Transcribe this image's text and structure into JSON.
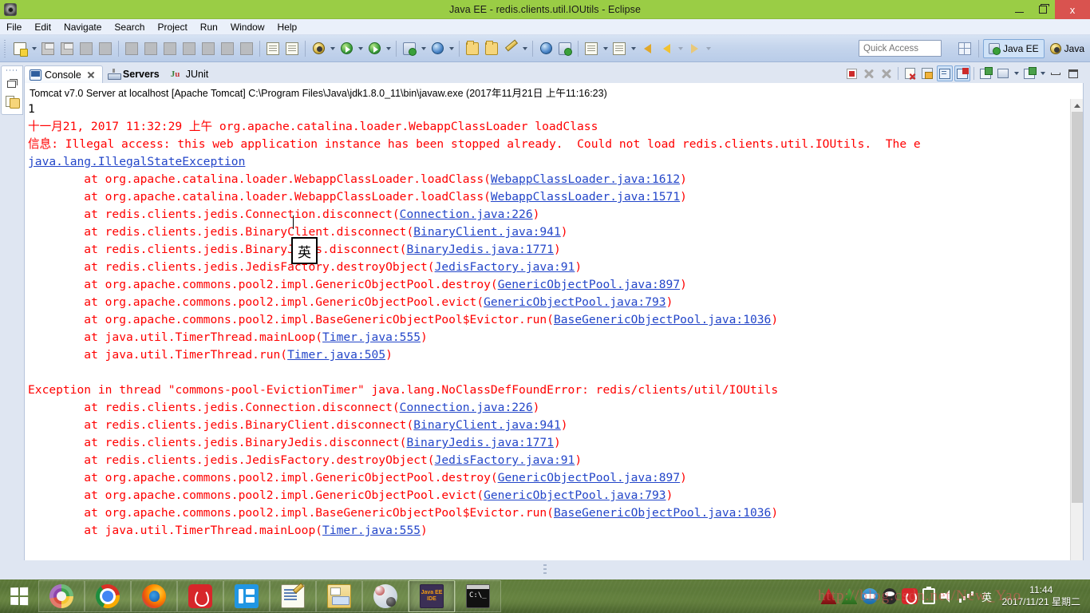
{
  "window": {
    "title": "Java EE - redis.clients.util.IOUtils - Eclipse",
    "app_icon": "eclipse-icon",
    "minimize_label": "–",
    "maximize_label": "❐",
    "close_label": "x"
  },
  "menubar": {
    "items": [
      {
        "label": "File"
      },
      {
        "label": "Edit"
      },
      {
        "label": "Navigate"
      },
      {
        "label": "Search"
      },
      {
        "label": "Project"
      },
      {
        "label": "Run"
      },
      {
        "label": "Window"
      },
      {
        "label": "Help"
      }
    ]
  },
  "toolbar": {
    "quick_access_placeholder": "Quick Access",
    "quick_access_value": "",
    "buttons": [
      {
        "icon": "new-wizard-icon",
        "has_caret": true
      },
      {
        "icon": "save-icon",
        "has_caret": false
      },
      {
        "icon": "save-all-icon",
        "has_caret": false
      },
      {
        "icon": "print-icon",
        "has_caret": false
      },
      {
        "icon": "toggle-breakpoint-icon",
        "has_caret": false
      },
      {
        "icon": "resume-icon",
        "has_caret": false
      },
      {
        "icon": "suspend-icon",
        "has_caret": false
      },
      {
        "icon": "terminate-icon",
        "has_caret": false
      },
      {
        "icon": "disconnect-icon",
        "has_caret": false
      },
      {
        "icon": "step-into-icon",
        "has_caret": false
      },
      {
        "icon": "step-over-icon",
        "has_caret": false
      },
      {
        "icon": "step-return-icon",
        "has_caret": false
      },
      {
        "icon": "open-task-icon",
        "has_caret": false
      },
      {
        "icon": "skip-breakpoints-icon",
        "has_caret": false
      },
      {
        "icon": "debug-icon",
        "has_caret": true
      },
      {
        "icon": "run-icon",
        "has_caret": true
      },
      {
        "icon": "run-external-tools-icon",
        "has_caret": true
      },
      {
        "icon": "new-server-icon",
        "has_caret": true
      },
      {
        "icon": "search-icon",
        "has_caret": true
      },
      {
        "icon": "open-type-icon",
        "has_caret": false
      },
      {
        "icon": "open-resource-icon",
        "has_caret": false
      },
      {
        "icon": "edit-icon",
        "has_caret": true
      },
      {
        "icon": "web-browser-icon",
        "has_caret": false
      },
      {
        "icon": "run-on-server-icon",
        "has_caret": false
      },
      {
        "icon": "new-java-class-icon",
        "has_caret": true
      },
      {
        "icon": "new-annotation-icon",
        "has_caret": true
      },
      {
        "icon": "previous-annotation-icon",
        "has_caret": false
      },
      {
        "icon": "back-icon",
        "has_caret": true
      },
      {
        "icon": "forward-icon",
        "has_caret": true
      }
    ],
    "perspective": {
      "open_perspective_icon": "open-perspective-icon",
      "items": [
        {
          "label": "Java EE",
          "icon": "java-ee-perspective-icon",
          "active": true
        },
        {
          "label": "Java",
          "icon": "java-perspective-icon",
          "active": false
        }
      ]
    }
  },
  "fastview": {
    "items": [
      {
        "icon": "restore-icon",
        "name": "restore"
      },
      {
        "icon": "project-explorer-icon",
        "name": "project-explorer"
      }
    ]
  },
  "view_stack": {
    "tabs": [
      {
        "label": "Console",
        "icon": "console-icon",
        "active": true,
        "closable": true,
        "bold": false
      },
      {
        "label": "Servers",
        "icon": "servers-icon",
        "active": false,
        "closable": false,
        "bold": true
      },
      {
        "label": "JUnit",
        "icon": "junit-icon",
        "active": false,
        "closable": false,
        "bold": false
      }
    ],
    "view_toolbar": [
      {
        "icon": "terminate-icon",
        "enabled": true,
        "toggled": false
      },
      {
        "icon": "remove-launch-icon",
        "enabled": false,
        "toggled": false
      },
      {
        "icon": "remove-all-launches-icon",
        "enabled": false,
        "toggled": false
      },
      {
        "icon": "clear-console-icon",
        "enabled": true,
        "toggled": false
      },
      {
        "icon": "scroll-lock-icon",
        "enabled": true,
        "toggled": false
      },
      {
        "icon": "pin-console-icon",
        "enabled": true,
        "toggled": true
      },
      {
        "icon": "display-selected-console-icon",
        "enabled": true,
        "toggled": true
      },
      {
        "icon": "open-console-icon",
        "enabled": true,
        "toggled": false
      },
      {
        "icon": "display-console-icon",
        "enabled": true,
        "toggled": false
      },
      {
        "icon": "new-console-view-icon",
        "enabled": true,
        "toggled": false
      },
      {
        "icon": "minimize-icon",
        "enabled": true,
        "toggled": false
      },
      {
        "icon": "maximize-icon",
        "enabled": true,
        "toggled": false
      }
    ],
    "console_label": "Tomcat v7.0 Server at localhost [Apache Tomcat] C:\\Program Files\\Java\\jdk1.8.0_11\\bin\\javaw.exe (2017年11月21日 上午11:16:23)"
  },
  "console": {
    "ime_indicator": "英",
    "lines": [
      {
        "kind": "black",
        "text": "1"
      },
      {
        "kind": "red",
        "text": "十一月21, 2017 11:32:29 上午 org.apache.catalina.loader.WebappClassLoader loadClass"
      },
      {
        "kind": "red",
        "text": "信息: Illegal access: this web application instance has been stopped already.  Could not load redis.clients.util.IOUtils.  The e"
      },
      {
        "kind": "link-full",
        "text": "java.lang.IllegalStateException"
      },
      {
        "kind": "trace",
        "prefix": "        at org.apache.catalina.loader.WebappClassLoader.loadClass(",
        "link": "WebappClassLoader.java:1612",
        "suffix": ")"
      },
      {
        "kind": "trace",
        "prefix": "        at org.apache.catalina.loader.WebappClassLoader.loadClass(",
        "link": "WebappClassLoader.java:1571",
        "suffix": ")"
      },
      {
        "kind": "trace",
        "prefix": "        at redis.clients.jedis.Connection.disconnect(",
        "link": "Connection.java:226",
        "suffix": ")"
      },
      {
        "kind": "trace",
        "prefix": "        at redis.clients.jedis.BinaryClient.disconnect(",
        "link": "BinaryClient.java:941",
        "suffix": ")"
      },
      {
        "kind": "trace",
        "prefix": "        at redis.clients.jedis.BinaryJedis.disconnect(",
        "link": "BinaryJedis.java:1771",
        "suffix": ")"
      },
      {
        "kind": "trace",
        "prefix": "        at redis.clients.jedis.JedisFactory.destroyObject(",
        "link": "JedisFactory.java:91",
        "suffix": ")"
      },
      {
        "kind": "trace",
        "prefix": "        at org.apache.commons.pool2.impl.GenericObjectPool.destroy(",
        "link": "GenericObjectPool.java:897",
        "suffix": ")"
      },
      {
        "kind": "trace",
        "prefix": "        at org.apache.commons.pool2.impl.GenericObjectPool.evict(",
        "link": "GenericObjectPool.java:793",
        "suffix": ")"
      },
      {
        "kind": "trace",
        "prefix": "        at org.apache.commons.pool2.impl.BaseGenericObjectPool$Evictor.run(",
        "link": "BaseGenericObjectPool.java:1036",
        "suffix": ")"
      },
      {
        "kind": "trace",
        "prefix": "        at java.util.TimerThread.mainLoop(",
        "link": "Timer.java:555",
        "suffix": ")"
      },
      {
        "kind": "trace",
        "prefix": "        at java.util.TimerThread.run(",
        "link": "Timer.java:505",
        "suffix": ")"
      },
      {
        "kind": "blank",
        "text": ""
      },
      {
        "kind": "red",
        "text": "Exception in thread \"commons-pool-EvictionTimer\" java.lang.NoClassDefFoundError: redis/clients/util/IOUtils"
      },
      {
        "kind": "trace",
        "prefix": "        at redis.clients.jedis.Connection.disconnect(",
        "link": "Connection.java:226",
        "suffix": ")"
      },
      {
        "kind": "trace",
        "prefix": "        at redis.clients.jedis.BinaryClient.disconnect(",
        "link": "BinaryClient.java:941",
        "suffix": ")"
      },
      {
        "kind": "trace",
        "prefix": "        at redis.clients.jedis.BinaryJedis.disconnect(",
        "link": "BinaryJedis.java:1771",
        "suffix": ")"
      },
      {
        "kind": "trace",
        "prefix": "        at redis.clients.jedis.JedisFactory.destroyObject(",
        "link": "JedisFactory.java:91",
        "suffix": ")"
      },
      {
        "kind": "trace",
        "prefix": "        at org.apache.commons.pool2.impl.GenericObjectPool.destroy(",
        "link": "GenericObjectPool.java:897",
        "suffix": ")"
      },
      {
        "kind": "trace",
        "prefix": "        at org.apache.commons.pool2.impl.GenericObjectPool.evict(",
        "link": "GenericObjectPool.java:793",
        "suffix": ")"
      },
      {
        "kind": "trace",
        "prefix": "        at org.apache.commons.pool2.impl.BaseGenericObjectPool$Evictor.run(",
        "link": "BaseGenericObjectPool.java:1036",
        "suffix": ")"
      },
      {
        "kind": "trace",
        "prefix": "        at java.util.TimerThread.mainLoop(",
        "link": "Timer.java:555",
        "suffix": ")"
      }
    ]
  },
  "taskbar": {
    "start_label": "start",
    "tasks": [
      {
        "name": "photos",
        "icon": "photos-icon",
        "pressed": false
      },
      {
        "name": "chrome",
        "icon": "chrome-icon",
        "pressed": false
      },
      {
        "name": "firefox",
        "icon": "firefox-icon",
        "pressed": false
      },
      {
        "name": "netease-music",
        "icon": "netease-music-icon",
        "pressed": false
      },
      {
        "name": "wps",
        "icon": "wps-icon",
        "pressed": false
      },
      {
        "name": "notepad",
        "icon": "notepad-icon",
        "pressed": false
      },
      {
        "name": "file-manager",
        "icon": "file-manager-icon",
        "pressed": false
      },
      {
        "name": "game",
        "icon": "game-icon",
        "pressed": false
      },
      {
        "name": "eclipse",
        "icon": "eclipse-taskbar-icon",
        "pressed": true,
        "badge": "Java EE IDE"
      },
      {
        "name": "command-prompt",
        "icon": "command-prompt-icon",
        "pressed": false
      }
    ],
    "tray": [
      {
        "name": "thunder",
        "icon": "thunder-icon"
      },
      {
        "name": "green-arrow",
        "icon": "green-arrow-icon"
      },
      {
        "name": "cloud-disk",
        "icon": "cloud-disk-icon"
      },
      {
        "name": "qq",
        "icon": "qq-icon"
      },
      {
        "name": "netease-music-tray",
        "icon": "netease-music-icon"
      },
      {
        "name": "battery",
        "icon": "battery-icon"
      },
      {
        "name": "volume",
        "icon": "volume-icon"
      },
      {
        "name": "network",
        "icon": "network-icon"
      },
      {
        "name": "ime",
        "icon": "ime-icon",
        "label": "英"
      }
    ],
    "clock": {
      "time": "11:44",
      "date": "2017/11/21 星期二"
    }
  },
  "watermark": {
    "text": "http://blog.csdn.net/New_Yao"
  }
}
